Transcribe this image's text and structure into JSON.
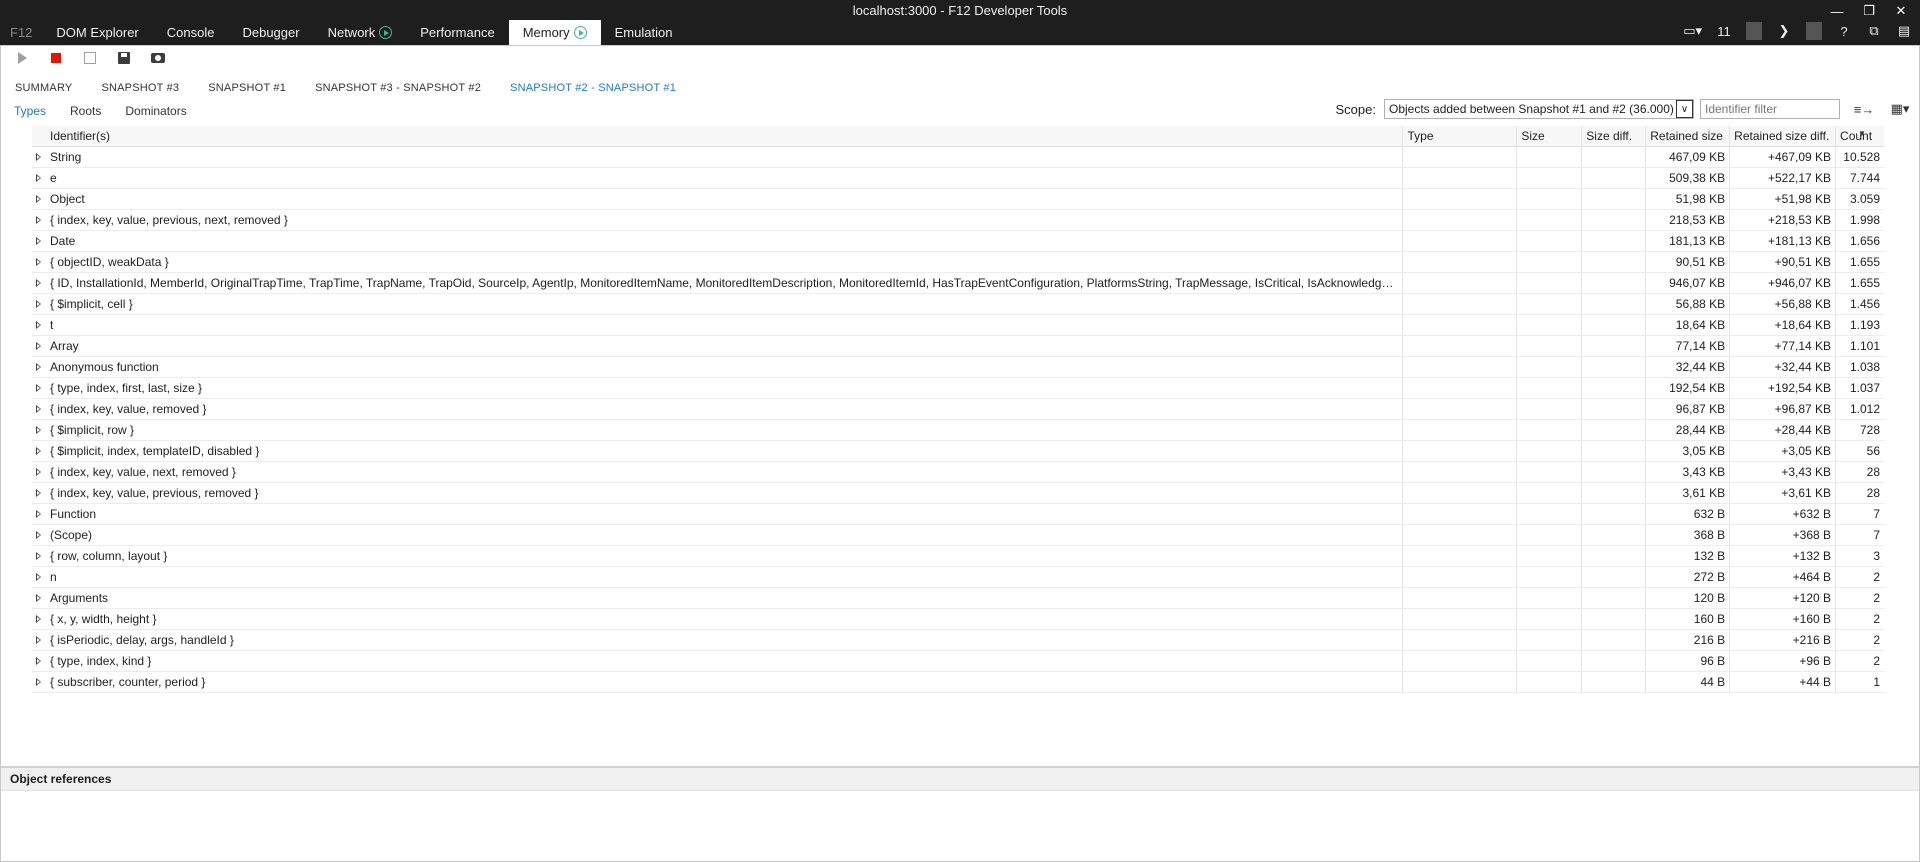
{
  "window": {
    "title": "localhost:3000 - F12 Developer Tools"
  },
  "maintabs": {
    "f12": "F12",
    "items": [
      "DOM Explorer",
      "Console",
      "Debugger",
      "Network",
      "Performance",
      "Memory",
      "Emulation"
    ],
    "active": "Memory"
  },
  "right_tools": {
    "target_count": "11",
    "icons": [
      "device-icon",
      "console-icon",
      "help-icon",
      "undock-icon",
      "dock-icon"
    ]
  },
  "snapshots": {
    "tabs": [
      "SUMMARY",
      "SNAPSHOT #3",
      "SNAPSHOT #1",
      "SNAPSHOT #3 - SNAPSHOT #2",
      "SNAPSHOT #2 - SNAPSHOT #1"
    ],
    "active": "SNAPSHOT #2 - SNAPSHOT #1"
  },
  "subtabs": {
    "items": [
      "Types",
      "Roots",
      "Dominators"
    ],
    "active": "Types"
  },
  "scope": {
    "label": "Scope:",
    "value": "Objects added between Snapshot #1 and #2 (36.000)",
    "filter_placeholder": "Identifier filter"
  },
  "columns": {
    "identifier": "Identifier(s)",
    "type": "Type",
    "size": "Size",
    "size_diff": "Size diff.",
    "retained": "Retained size",
    "retained_diff": "Retained size diff.",
    "count": "Count"
  },
  "rows": [
    {
      "id": "String",
      "retained": "467,09 KB",
      "rdiff": "+467,09 KB",
      "count": "10.528"
    },
    {
      "id": "e",
      "retained": "509,38 KB",
      "rdiff": "+522,17 KB",
      "count": "7.744"
    },
    {
      "id": "Object",
      "retained": "51,98 KB",
      "rdiff": "+51,98 KB",
      "count": "3.059"
    },
    {
      "id": "{ index, key, value, previous, next, removed }",
      "retained": "218,53 KB",
      "rdiff": "+218,53 KB",
      "count": "1.998"
    },
    {
      "id": "Date",
      "retained": "181,13 KB",
      "rdiff": "+181,13 KB",
      "count": "1.656"
    },
    {
      "id": "{ objectID, weakData }",
      "retained": "90,51 KB",
      "rdiff": "+90,51 KB",
      "count": "1.655"
    },
    {
      "id": "{ ID, InstallationId, MemberId, OriginalTrapTime, TrapTime, TrapName, TrapOid, SourceIp, AgentIp, MonitoredItemName, MonitoredItemDescription, MonitoredItemId, HasTrapEventConfiguration, PlatformsString, TrapMessage, IsCritical, IsAcknowledgeR...",
      "retained": "946,07 KB",
      "rdiff": "+946,07 KB",
      "count": "1.655"
    },
    {
      "id": "{ $implicit, cell }",
      "retained": "56,88 KB",
      "rdiff": "+56,88 KB",
      "count": "1.456"
    },
    {
      "id": "t",
      "retained": "18,64 KB",
      "rdiff": "+18,64 KB",
      "count": "1.193"
    },
    {
      "id": "Array",
      "retained": "77,14 KB",
      "rdiff": "+77,14 KB",
      "count": "1.101"
    },
    {
      "id": "Anonymous function",
      "retained": "32,44 KB",
      "rdiff": "+32,44 KB",
      "count": "1.038"
    },
    {
      "id": "{ type, index, first, last, size }",
      "retained": "192,54 KB",
      "rdiff": "+192,54 KB",
      "count": "1.037"
    },
    {
      "id": "{ index, key, value, removed }",
      "retained": "96,87 KB",
      "rdiff": "+96,87 KB",
      "count": "1.012"
    },
    {
      "id": "{ $implicit, row }",
      "retained": "28,44 KB",
      "rdiff": "+28,44 KB",
      "count": "728"
    },
    {
      "id": "{ $implicit, index, templateID, disabled }",
      "retained": "3,05 KB",
      "rdiff": "+3,05 KB",
      "count": "56"
    },
    {
      "id": "{ index, key, value, next, removed }",
      "retained": "3,43 KB",
      "rdiff": "+3,43 KB",
      "count": "28"
    },
    {
      "id": "{ index, key, value, previous, removed }",
      "retained": "3,61 KB",
      "rdiff": "+3,61 KB",
      "count": "28"
    },
    {
      "id": "Function",
      "retained": "632 B",
      "rdiff": "+632 B",
      "count": "7"
    },
    {
      "id": "(Scope)",
      "retained": "368 B",
      "rdiff": "+368 B",
      "count": "7"
    },
    {
      "id": "{ row, column, layout }",
      "retained": "132 B",
      "rdiff": "+132 B",
      "count": "3"
    },
    {
      "id": "n",
      "retained": "272 B",
      "rdiff": "+464 B",
      "count": "2"
    },
    {
      "id": "Arguments",
      "retained": "120 B",
      "rdiff": "+120 B",
      "count": "2"
    },
    {
      "id": "{ x, y, width, height }",
      "retained": "160 B",
      "rdiff": "+160 B",
      "count": "2"
    },
    {
      "id": "{ isPeriodic, delay, args, handleId }",
      "retained": "216 B",
      "rdiff": "+216 B",
      "count": "2"
    },
    {
      "id": "{ type, index, kind }",
      "retained": "96 B",
      "rdiff": "+96 B",
      "count": "2"
    },
    {
      "id": "{ subscriber, counter, period }",
      "retained": "44 B",
      "rdiff": "+44 B",
      "count": "1"
    }
  ],
  "object_references": {
    "title": "Object references"
  }
}
